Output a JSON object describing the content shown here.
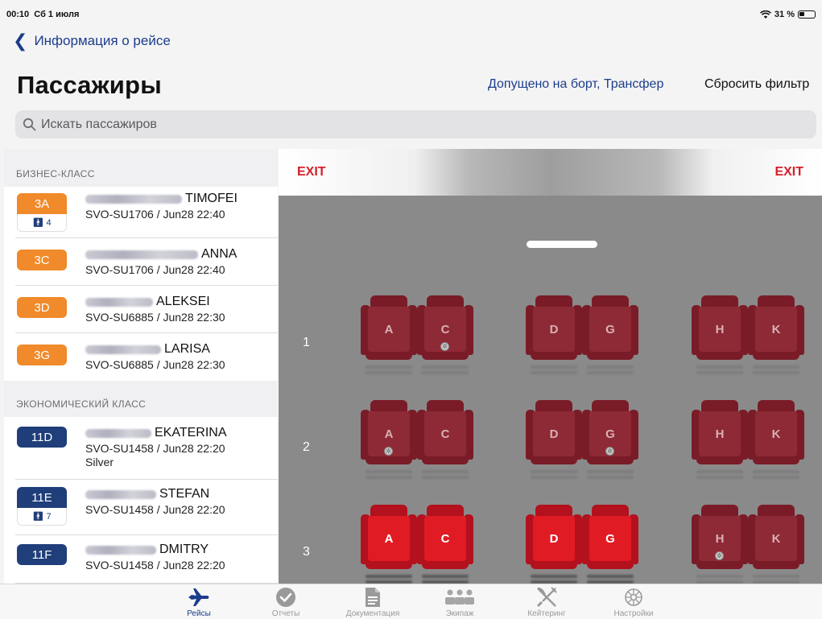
{
  "status_bar": {
    "time": "00:10",
    "date": "Сб 1 июля",
    "battery": "31 %"
  },
  "nav": {
    "back_label": "Информация о рейсе"
  },
  "header": {
    "title": "Пассажиры",
    "filter_label": "Допущено на борт, Трансфер",
    "reset_label": "Сбросить фильтр"
  },
  "search": {
    "placeholder": "Искать пассажиров"
  },
  "sections": [
    {
      "title": "БИЗНЕС-КЛАСС",
      "passengers": [
        {
          "seat": "3A",
          "extra": "4",
          "name": "TIMOFEI",
          "flight": "SVO-SU1706 / Jun28 22:40",
          "tier": ""
        },
        {
          "seat": "3C",
          "extra": "",
          "name": "ANNA",
          "flight": "SVO-SU1706 / Jun28 22:40",
          "tier": ""
        },
        {
          "seat": "3D",
          "extra": "",
          "name": "ALEKSEI",
          "flight": "SVO-SU6885 / Jun28 22:30",
          "tier": ""
        },
        {
          "seat": "3G",
          "extra": "",
          "name": "LARISA",
          "flight": "SVO-SU6885 / Jun28 22:30",
          "tier": ""
        }
      ]
    },
    {
      "title": "ЭКОНОМИЧЕСКИЙ КЛАСС",
      "passengers": [
        {
          "seat": "11D",
          "extra": "",
          "name": "EKATERINA",
          "flight": "SVO-SU1458 / Jun28 22:20",
          "tier": "Silver"
        },
        {
          "seat": "11E",
          "extra": "7",
          "name": "STEFAN",
          "flight": "SVO-SU1458 / Jun28 22:20",
          "tier": ""
        },
        {
          "seat": "11F",
          "extra": "",
          "name": "DMITRY",
          "flight": "SVO-SU1458 / Jun28 22:20",
          "tier": ""
        }
      ]
    }
  ],
  "seatmap": {
    "exit_left": "EXIT",
    "exit_right": "EXIT",
    "rows": [
      {
        "number": "1",
        "seats": [
          {
            "letter": "A",
            "state": "dim",
            "dot": false
          },
          {
            "letter": "C",
            "state": "dim",
            "dot": true
          },
          {
            "letter": "D",
            "state": "dim",
            "dot": false
          },
          {
            "letter": "G",
            "state": "dim",
            "dot": false
          },
          {
            "letter": "H",
            "state": "dim",
            "dot": false
          },
          {
            "letter": "K",
            "state": "dim",
            "dot": false
          }
        ]
      },
      {
        "number": "2",
        "seats": [
          {
            "letter": "A",
            "state": "dim",
            "dot": true
          },
          {
            "letter": "C",
            "state": "dim",
            "dot": false
          },
          {
            "letter": "D",
            "state": "dim",
            "dot": false
          },
          {
            "letter": "G",
            "state": "dim",
            "dot": true
          },
          {
            "letter": "H",
            "state": "dim",
            "dot": false
          },
          {
            "letter": "K",
            "state": "dim",
            "dot": false
          }
        ]
      },
      {
        "number": "3",
        "seats": [
          {
            "letter": "A",
            "state": "active",
            "dot": false
          },
          {
            "letter": "C",
            "state": "active",
            "dot": false
          },
          {
            "letter": "D",
            "state": "active",
            "dot": false
          },
          {
            "letter": "G",
            "state": "active",
            "dot": false
          },
          {
            "letter": "H",
            "state": "dim",
            "dot": true
          },
          {
            "letter": "K",
            "state": "dim",
            "dot": false
          }
        ]
      }
    ]
  },
  "tabs": [
    {
      "label": "Рейсы",
      "icon": "plane-icon",
      "active": true
    },
    {
      "label": "Отчеты",
      "icon": "check-circle-icon",
      "active": false
    },
    {
      "label": "Документация",
      "icon": "document-icon",
      "active": false
    },
    {
      "label": "Экипаж",
      "icon": "crew-icon",
      "active": false
    },
    {
      "label": "Кейтеринг",
      "icon": "catering-icon",
      "active": false
    },
    {
      "label": "Настройки",
      "icon": "settings-icon",
      "active": false
    }
  ],
  "colors": {
    "accent": "#1c3d8c",
    "business_badge": "#f08a2a",
    "economy_badge": "#1f3e7a",
    "exit": "#d4202a",
    "seat_active": "#e01b24",
    "seat_dim": "#8e2a35"
  }
}
